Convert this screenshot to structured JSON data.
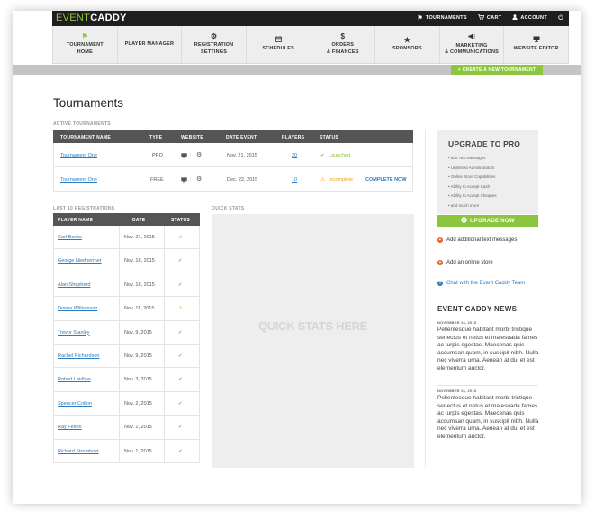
{
  "app": {
    "logo_part1": "EVENT",
    "logo_part2": "CADDY"
  },
  "topnav": [
    {
      "icon": "flag-icon",
      "label": "TOURNAMENTS"
    },
    {
      "icon": "cart-icon",
      "label": "CART"
    },
    {
      "icon": "user-icon",
      "label": "ACCOUNT"
    },
    {
      "icon": "power-icon",
      "label": ""
    }
  ],
  "mainnav": [
    {
      "icon": "flag-icon",
      "label": "TOURNAMENT\nHOME",
      "active": true
    },
    {
      "icon": "",
      "label": "PLAYER  MANAGER"
    },
    {
      "icon": "gear-icon",
      "label": "REGISTRATION\nSETTINGS"
    },
    {
      "icon": "calendar-icon",
      "label": "SCHEDULES"
    },
    {
      "icon": "dollar-icon",
      "label": "ORDERS\n& FINANCES"
    },
    {
      "icon": "star-icon",
      "label": "SPONSORS"
    },
    {
      "icon": "megaphone-icon",
      "label": "MARKETING\n& COMMUNICATIONS"
    },
    {
      "icon": "monitor-icon",
      "label": "WEBSITE EDITOR"
    }
  ],
  "create_button": "+ CREATE A NEW TOURNAMENT",
  "page_title": "Tournaments",
  "active": {
    "label": "ACTIVE TOURNAMENTS",
    "headers": [
      "TOURNAMENT NAME",
      "TYPE",
      "WEBSITE",
      "DATE EVENT",
      "PLAYERS",
      "STATUS"
    ],
    "rows": [
      {
        "name": "Tournament One",
        "type": "PRO",
        "date": "Nov. 21, 2015",
        "players": "20",
        "status": "Launched",
        "status_kind": "ok",
        "action": ""
      },
      {
        "name": "Tournament One",
        "type": "FREE",
        "date": "Dec. 22, 2015",
        "players": "10",
        "status": "Incomplete",
        "status_kind": "warn",
        "action": "COMPLETE NOW"
      }
    ]
  },
  "registrations": {
    "label": "LAST 10  REGISTRATIONS",
    "headers": [
      "PLAYER  NAME",
      "DATE",
      "STATUS"
    ],
    "rows": [
      {
        "name": "Carl Banks",
        "date": "Nov. 21, 2015",
        "status": "warn"
      },
      {
        "name": "George Niedhermer",
        "date": "Nov. 18, 2015",
        "status": "ok"
      },
      {
        "name": "Alan Shepherd",
        "date": "Nov. 18, 2015",
        "status": "ok"
      },
      {
        "name": "Donna Williamson",
        "date": "Nov. 11, 2015",
        "status": "warn"
      },
      {
        "name": "Trevor Stanley",
        "date": "Nov. 9, 2015",
        "status": "ok"
      },
      {
        "name": "Rachel Richardson",
        "date": "Nov. 9, 2015",
        "status": "ok"
      },
      {
        "name": "Robert Laidlaw",
        "date": "Nov. 3, 2015",
        "status": "ok"
      },
      {
        "name": "Spencer Colton",
        "date": "Nov. 2, 2015",
        "status": "ok"
      },
      {
        "name": "Ray Felton",
        "date": "Nov. 1, 2015",
        "status": "ok"
      },
      {
        "name": "Richard Strombost",
        "date": "Nov. 1, 2015",
        "status": "ok"
      }
    ]
  },
  "quick_stats": {
    "label": "QUICK STATS",
    "placeholder": "QUICK STATS HERE"
  },
  "upgrade": {
    "title": "UPGRADE TO PRO",
    "features": [
      "• 500 Text Messages",
      "• Unlimited Administrators",
      "• Online Store Capabilities",
      "• Ability to Accept Cash",
      "• Ability to Accept Cheques",
      "• and much more"
    ],
    "button": "UPGRADE  NOW"
  },
  "actions": {
    "text_messages": "Add additional text messages",
    "online_store": "Add an online store",
    "chat": "Chat with the Event Caddy Team"
  },
  "news": {
    "title": "EVENT CADDY NEWS",
    "items": [
      {
        "date": "NOVEMBER 16, 2015",
        "body": "Pellentesque habitant morbi tristique senectus et netus et malesuada fames ac turpis egestas. Maecenas quis accumsan quam, in suscipit nibh. Nulla nec viverra urna. Aenean at dui et est elementum auctor."
      },
      {
        "date": "NOVEMBER 16, 2015",
        "body": "Pellentesque habitant morbi tristique senectus et netus et malesuada fames ac turpis egestas. Maecenas quis accumsan quam, in suscipit nibh. Nulla nec viverra urna. Aenean at dui et est elementum auctor."
      }
    ]
  },
  "colors": {
    "accent": "#8cc63f",
    "link": "#2a7bbf",
    "warn": "#f0a500",
    "dark": "#1e1e1e"
  }
}
